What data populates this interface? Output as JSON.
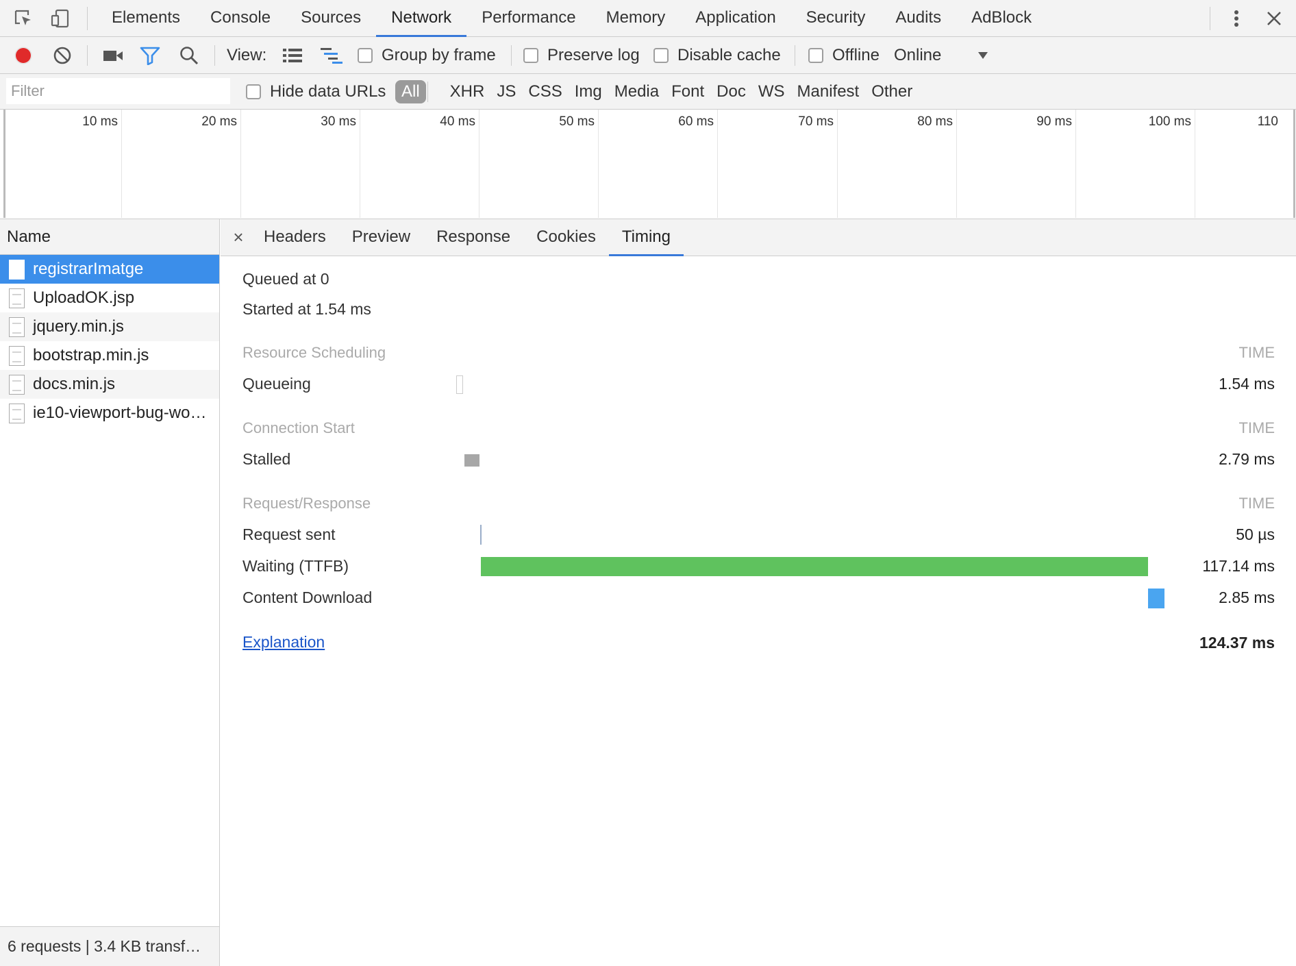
{
  "devtools": {
    "tabs": [
      "Elements",
      "Console",
      "Sources",
      "Network",
      "Performance",
      "Memory",
      "Application",
      "Security",
      "Audits",
      "AdBlock"
    ],
    "active_tab": "Network"
  },
  "toolbar": {
    "view_label": "View:",
    "group_by_frame": "Group by frame",
    "preserve_log": "Preserve log",
    "disable_cache": "Disable cache",
    "offline": "Offline",
    "throttle": "Online",
    "record_color": "#e02a2a",
    "filter_color": "#3b8eea"
  },
  "filter": {
    "placeholder": "Filter",
    "hide_data_urls": "Hide data URLs",
    "types": [
      "All",
      "XHR",
      "JS",
      "CSS",
      "Img",
      "Media",
      "Font",
      "Doc",
      "WS",
      "Manifest",
      "Other"
    ],
    "active_type": "All"
  },
  "overview": {
    "ticks": [
      "10 ms",
      "20 ms",
      "30 ms",
      "40 ms",
      "50 ms",
      "60 ms",
      "70 ms",
      "80 ms",
      "90 ms",
      "100 ms",
      "110"
    ]
  },
  "requests": {
    "header": "Name",
    "items": [
      {
        "name": "registrarImatge",
        "selected": true
      },
      {
        "name": "UploadOK.jsp",
        "selected": false
      },
      {
        "name": "jquery.min.js",
        "selected": false
      },
      {
        "name": "bootstrap.min.js",
        "selected": false
      },
      {
        "name": "docs.min.js",
        "selected": false
      },
      {
        "name": "ie10-viewport-bug-wo…",
        "selected": false
      }
    ],
    "summary": "6 requests | 3.4 KB transf…"
  },
  "detail": {
    "tabs": [
      "Headers",
      "Preview",
      "Response",
      "Cookies",
      "Timing"
    ],
    "active_tab": "Timing",
    "close_label": "×"
  },
  "timing": {
    "queued_at": "Queued at 0",
    "started_at": "Started at 1.54 ms",
    "time_label": "TIME",
    "sections": [
      {
        "title": "Resource Scheduling",
        "rows": [
          {
            "label": "Queueing",
            "value": "1.54 ms"
          }
        ]
      },
      {
        "title": "Connection Start",
        "rows": [
          {
            "label": "Stalled",
            "value": "2.79 ms"
          }
        ]
      },
      {
        "title": "Request/Response",
        "rows": [
          {
            "label": "Request sent",
            "value": "50 µs"
          },
          {
            "label": "Waiting (TTFB)",
            "value": "117.14 ms"
          },
          {
            "label": "Content Download",
            "value": "2.85 ms"
          }
        ]
      }
    ],
    "explanation": "Explanation",
    "total": "124.37 ms",
    "colors": {
      "queueing": "#ffffff",
      "stalled": "#a7a7a7",
      "request": "#9aaec9",
      "waiting": "#5fc25e",
      "download": "#4aa5f0"
    }
  }
}
